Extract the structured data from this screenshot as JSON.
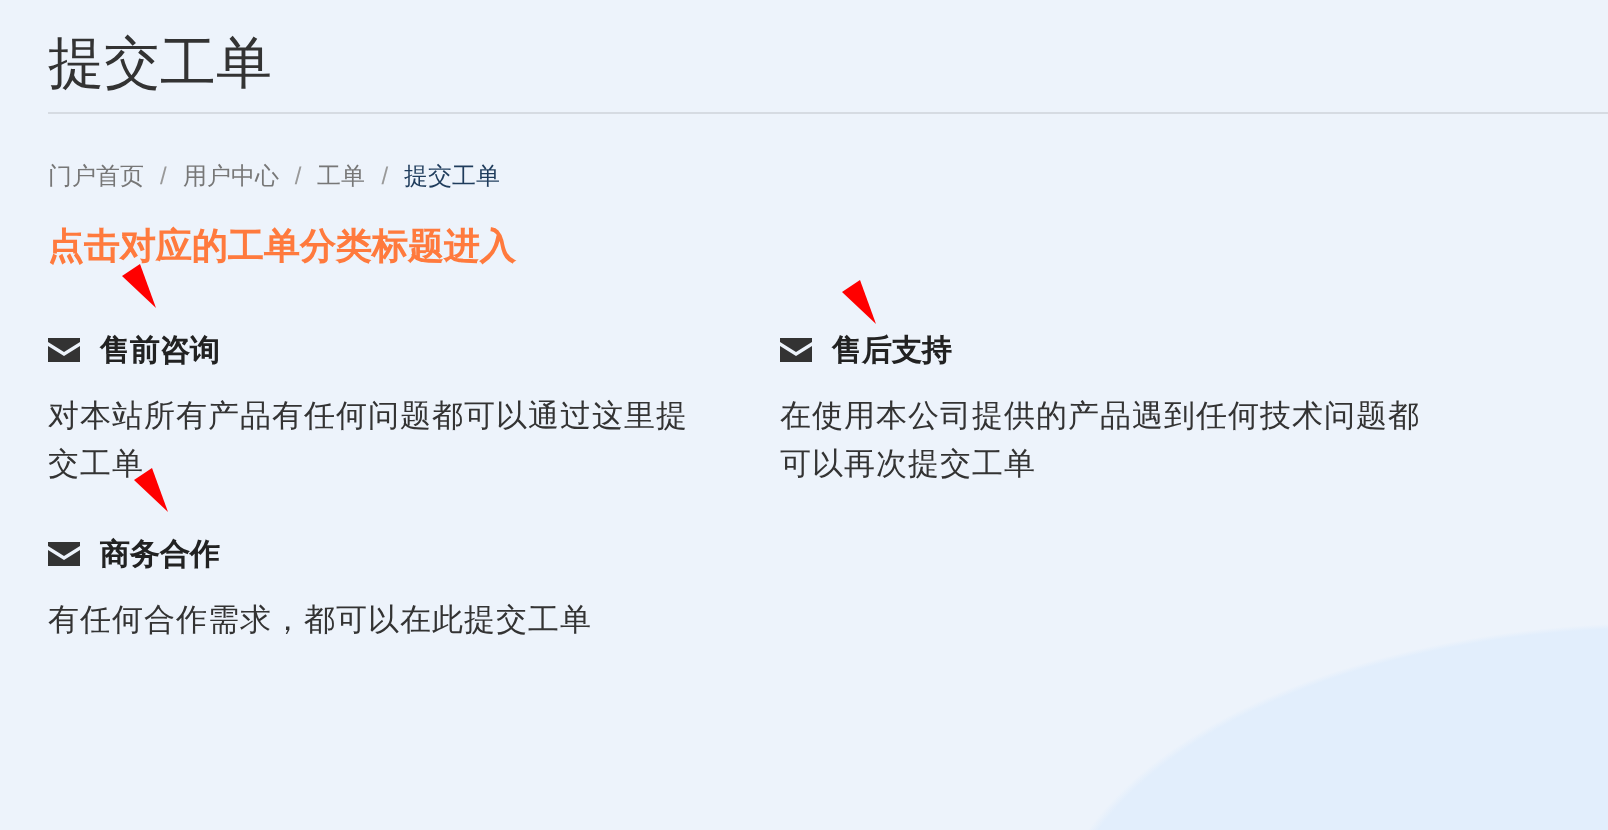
{
  "page_title": "提交工单",
  "breadcrumb": [
    {
      "label": "门户首页",
      "current": false
    },
    {
      "label": "用户中心",
      "current": false
    },
    {
      "label": "工单",
      "current": false
    },
    {
      "label": "提交工单",
      "current": true
    }
  ],
  "separator": "/",
  "hint": "点击对应的工单分类标题进入",
  "categories": [
    {
      "title": "售前咨询",
      "description": "对本站所有产品有任何问题都可以通过这里提交工单"
    },
    {
      "title": "售后支持",
      "description": "在使用本公司提供的产品遇到任何技术问题都可以再次提交工单"
    },
    {
      "title": "商务合作",
      "description": "有任何合作需求，都可以在此提交工单"
    }
  ]
}
